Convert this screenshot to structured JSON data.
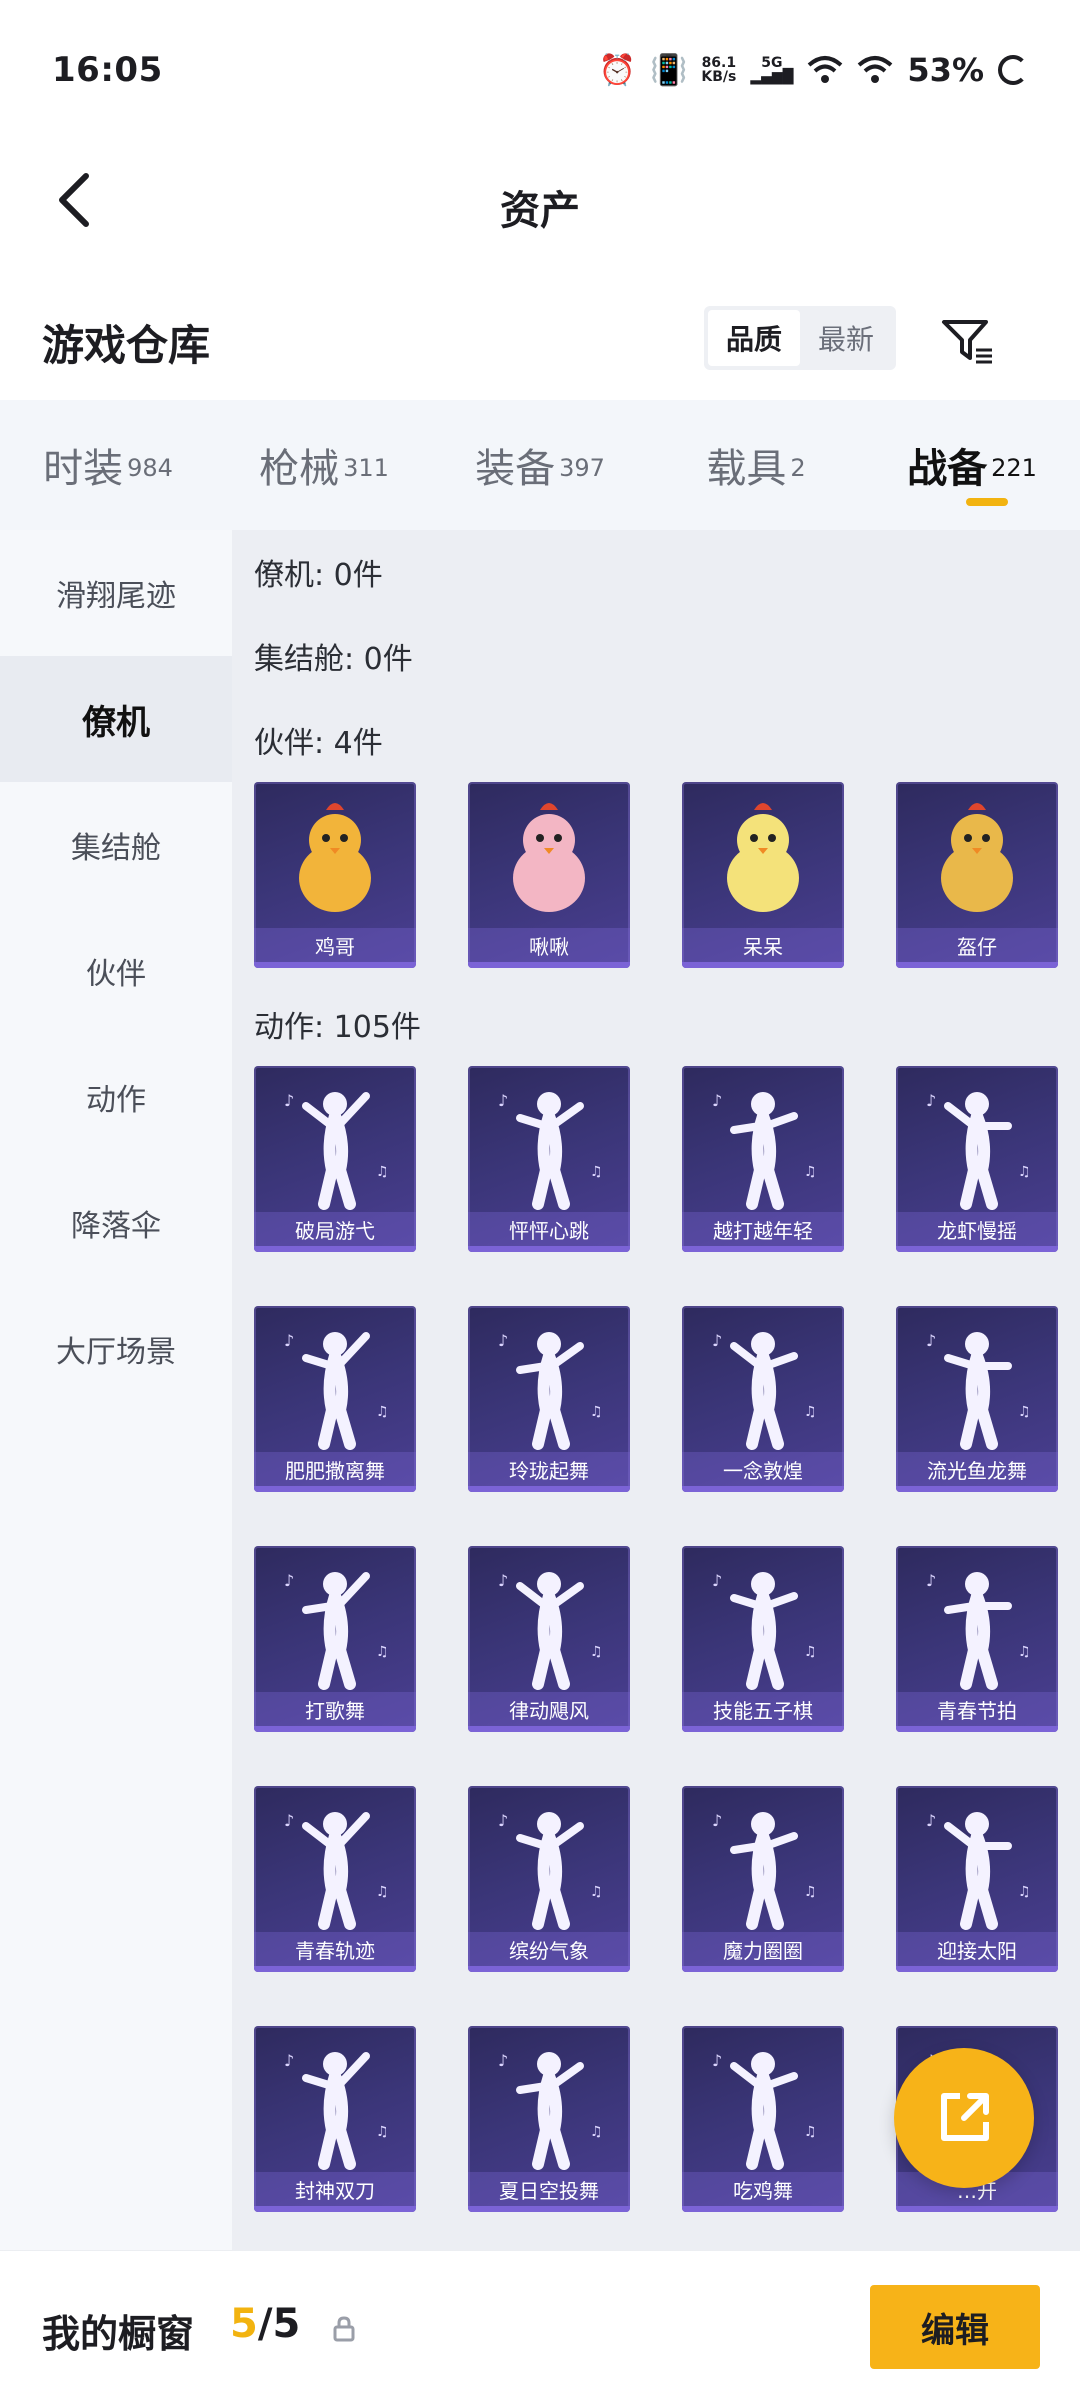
{
  "status_bar": {
    "time": "16:05",
    "net_speed_value": "86.1",
    "net_speed_unit": "KB/s",
    "signal_label": "5G",
    "battery": "53%",
    "icons": [
      "alarm-icon",
      "vibrate-icon",
      "signal-icon",
      "wifi-icon",
      "wifi-icon",
      "battery-icon"
    ]
  },
  "header": {
    "title": "资产",
    "back_icon": "chevron-left-icon"
  },
  "warehouse": {
    "title": "游戏仓库",
    "sort_options": [
      "品质",
      "最新"
    ],
    "sort_selected": "品质",
    "filter_icon": "filter-icon"
  },
  "category_tabs": [
    {
      "label": "时装",
      "count": "984"
    },
    {
      "label": "枪械",
      "count": "311"
    },
    {
      "label": "装备",
      "count": "397"
    },
    {
      "label": "载具",
      "count": "2"
    },
    {
      "label": "战备",
      "count": "221",
      "active": true
    }
  ],
  "sidebar": {
    "items": [
      "滑翔尾迹",
      "僚机",
      "集结舱",
      "伙伴",
      "动作",
      "降落伞",
      "大厅场景"
    ],
    "active": "僚机"
  },
  "sections": {
    "wingman": "僚机: 0件",
    "capsule": "集结舱: 0件",
    "partner": "伙伴: 4件",
    "emote": "动作: 105件"
  },
  "partner_items": [
    "鸡哥",
    "啾啾",
    "呆呆",
    "盔仔"
  ],
  "emote_items": [
    "破局游弋",
    "怦怦心跳",
    "越打越年轻",
    "龙虾慢摇",
    "肥肥撒离舞",
    "玲珑起舞",
    "一念敦煌",
    "流光鱼龙舞",
    "打歌舞",
    "律动飓风",
    "技能五子棋",
    "青春节拍",
    "青春轨迹",
    "缤纷气象",
    "魔力圈圈",
    "迎接太阳",
    "封神双刀",
    "夏日空投舞",
    "吃鸡舞",
    "…开"
  ],
  "bottom_bar": {
    "label": "我的橱窗",
    "current": "5",
    "total": "/5",
    "edit_label": "编辑",
    "lock_icon": "lock-icon"
  },
  "fab": {
    "icon": "share-icon"
  },
  "colors": {
    "accent": "#f7b318",
    "card_bg": "#3a3577",
    "tab_bg": "#f3f6fa"
  }
}
